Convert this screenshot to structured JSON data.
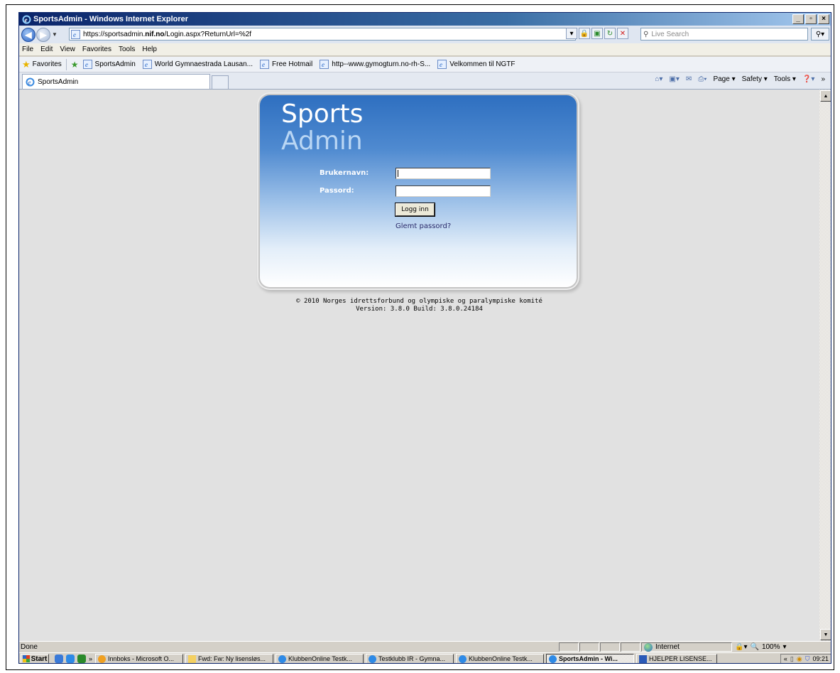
{
  "window": {
    "title": "SportsAdmin - Windows Internet Explorer",
    "controls": [
      "_",
      "▫",
      "×"
    ]
  },
  "address": {
    "url_prefix": "https://sportsadmin.",
    "url_bold": "nif.no",
    "url_suffix": "/Login.aspx?ReturnUrl=%2f",
    "search_placeholder": "Live Search"
  },
  "menu": [
    "File",
    "Edit",
    "View",
    "Favorites",
    "Tools",
    "Help"
  ],
  "favorites": {
    "label": "Favorites",
    "items": [
      "SportsAdmin",
      "World Gymnaestrada Lausan...",
      "Free Hotmail",
      "http--www.gymogturn.no-rh-S...",
      "Velkommen til NGTF"
    ]
  },
  "tab": {
    "title": "SportsAdmin"
  },
  "commandbar": {
    "page": "Page",
    "safety": "Safety",
    "tools": "Tools"
  },
  "login": {
    "logo_line1": "Sports",
    "logo_line2": "Admin",
    "username_label": "Brukernavn:",
    "password_label": "Passord:",
    "username_value": "",
    "password_value": "",
    "submit_label": "Logg inn",
    "forgot_link": "Glemt passord?"
  },
  "footer": {
    "copyright": "© 2010 Norges idrettsforbund og olympiske og paralympiske komité",
    "version": "Version: 3.8.0 Build: 3.8.0.24184"
  },
  "status": {
    "text": "Done",
    "zone": "Internet",
    "zoom": "100%"
  },
  "taskbar": {
    "start": "Start",
    "chevron": "»",
    "tasks": [
      "Innboks - Microsoft O...",
      "Fwd: Fw: Ny lisensløs...",
      "KlubbenOnline Testk...",
      "Testklubb IR - Gymna...",
      "KlubbenOnline Testk...",
      "SportsAdmin - Wi...",
      "HJELPER LISENSE..."
    ],
    "active_index": 5,
    "clock": "09:21"
  },
  "colors": {
    "login_top": "#2e6fc0",
    "page_background": "#e1e1e1",
    "title_bar": "#0a246a"
  }
}
